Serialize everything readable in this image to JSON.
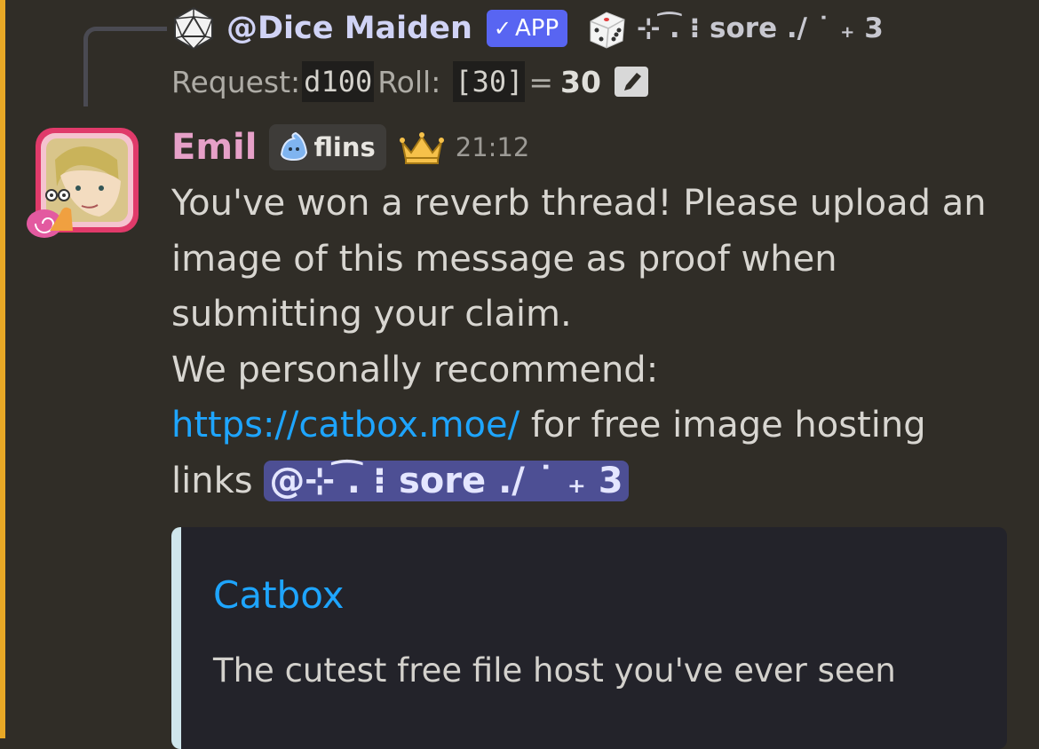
{
  "reply": {
    "bot_name": "@Dice Maiden",
    "badge_label": "APP",
    "mention_text": "⊹ ͡. ⁝ sore ./ ˙ ₊ 3",
    "request_label": "Request:",
    "request_value": "d100",
    "roll_label": "Roll:",
    "roll_value": "[30]",
    "equals": "=",
    "roll_total": "30"
  },
  "message": {
    "username": "Emil",
    "tag_label": "flins",
    "timestamp": "21:12",
    "line1": "You've won a reverb thread! Please upload an image of this message as proof when submitting your claim.",
    "line2_prefix": "We personally recommend:",
    "link": "https://catbox.moe/",
    "line2_suffix": "for free image hosting links",
    "mention": "@⊹ ͡. ⁝ sore ./ ˙ ₊ 3"
  },
  "embed": {
    "title": "Catbox",
    "description": "The cutest free file host you've ever seen"
  },
  "colors": {
    "background": "#302d27",
    "left_bar": "#e8a826",
    "username": "#e6a0c8",
    "link": "#1ea5ff",
    "app_badge": "#5865f2",
    "mention_chip": "#4d4f94",
    "embed_accent": "#cfe6ec"
  },
  "icons": [
    "d20-avatar-icon",
    "check-icon",
    "dice-icon",
    "edit-icon",
    "user-avatar",
    "snail-icon",
    "slime-icon",
    "crown-icon"
  ]
}
